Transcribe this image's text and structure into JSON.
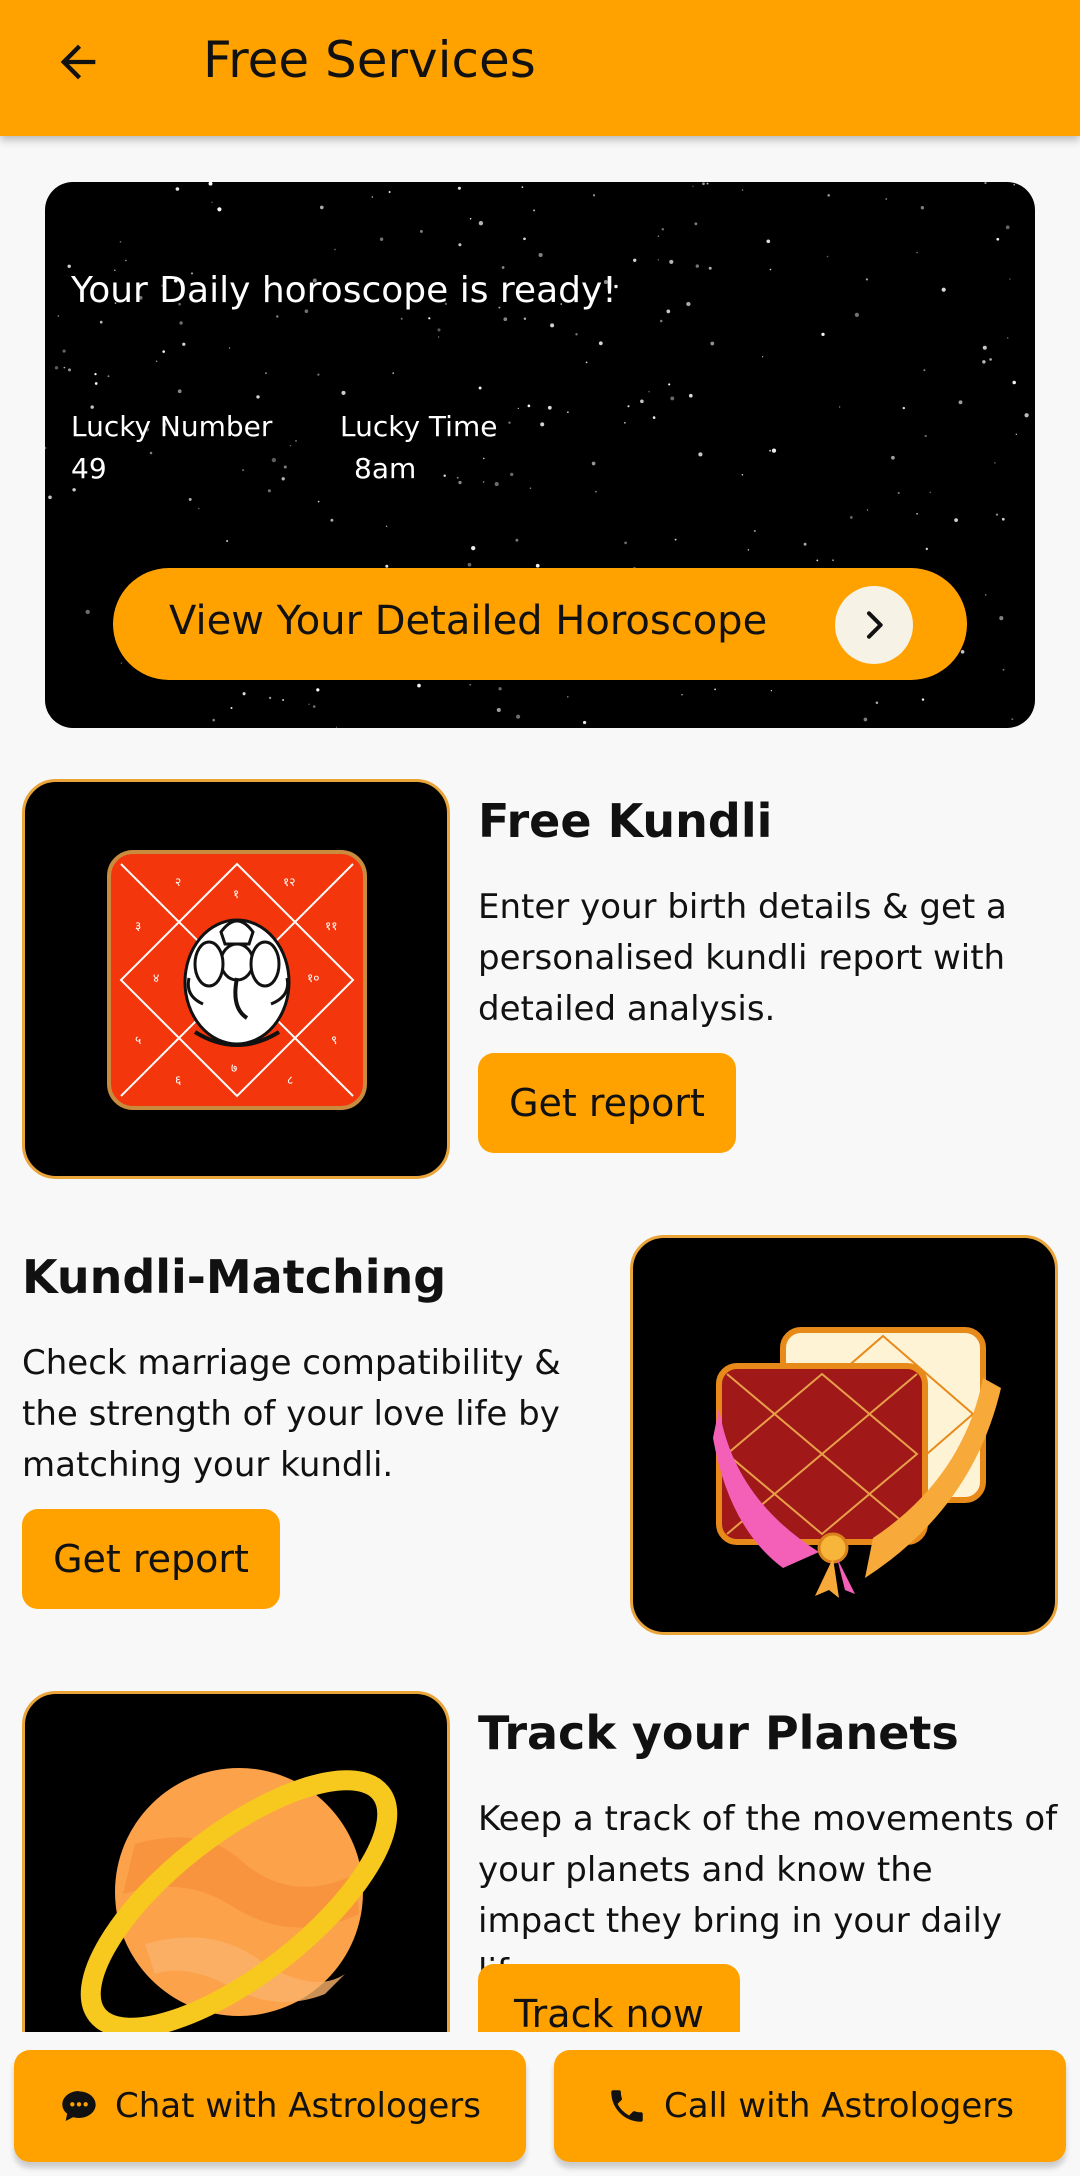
{
  "appbar": {
    "title": "Free Services"
  },
  "horoscope": {
    "title": "Your Daily horoscope is ready!",
    "lucky_number_label": "Lucky Number",
    "lucky_number_value": "49",
    "lucky_time_label": "Lucky Time",
    "lucky_time_value": "8am",
    "button_label": "View Your Detailed Horoscope"
  },
  "services": [
    {
      "title": "Free Kundli",
      "description": "Enter your birth details & get a personalised kundli report with detailed analysis.",
      "button": "Get report"
    },
    {
      "title": "Kundli-Matching",
      "description": "Check marriage compatibility & the strength of your love life by matching your kundli.",
      "button": "Get report"
    },
    {
      "title": "Track your Planets",
      "description": "Keep a track of the movements of your planets and know the impact they bring in your daily life.",
      "button": "Track now"
    }
  ],
  "bottom_bar": {
    "chat_label": "Chat with Astrologers",
    "call_label": "Call with Astrologers"
  },
  "colors": {
    "accent": "#ffa200",
    "card_border": "#e9a43a",
    "background": "#f8f8f8"
  },
  "icons": {
    "back": "arrow-left-icon",
    "chevron": "chevron-right-icon",
    "chat": "chat-bubble-icon",
    "call": "phone-icon"
  }
}
